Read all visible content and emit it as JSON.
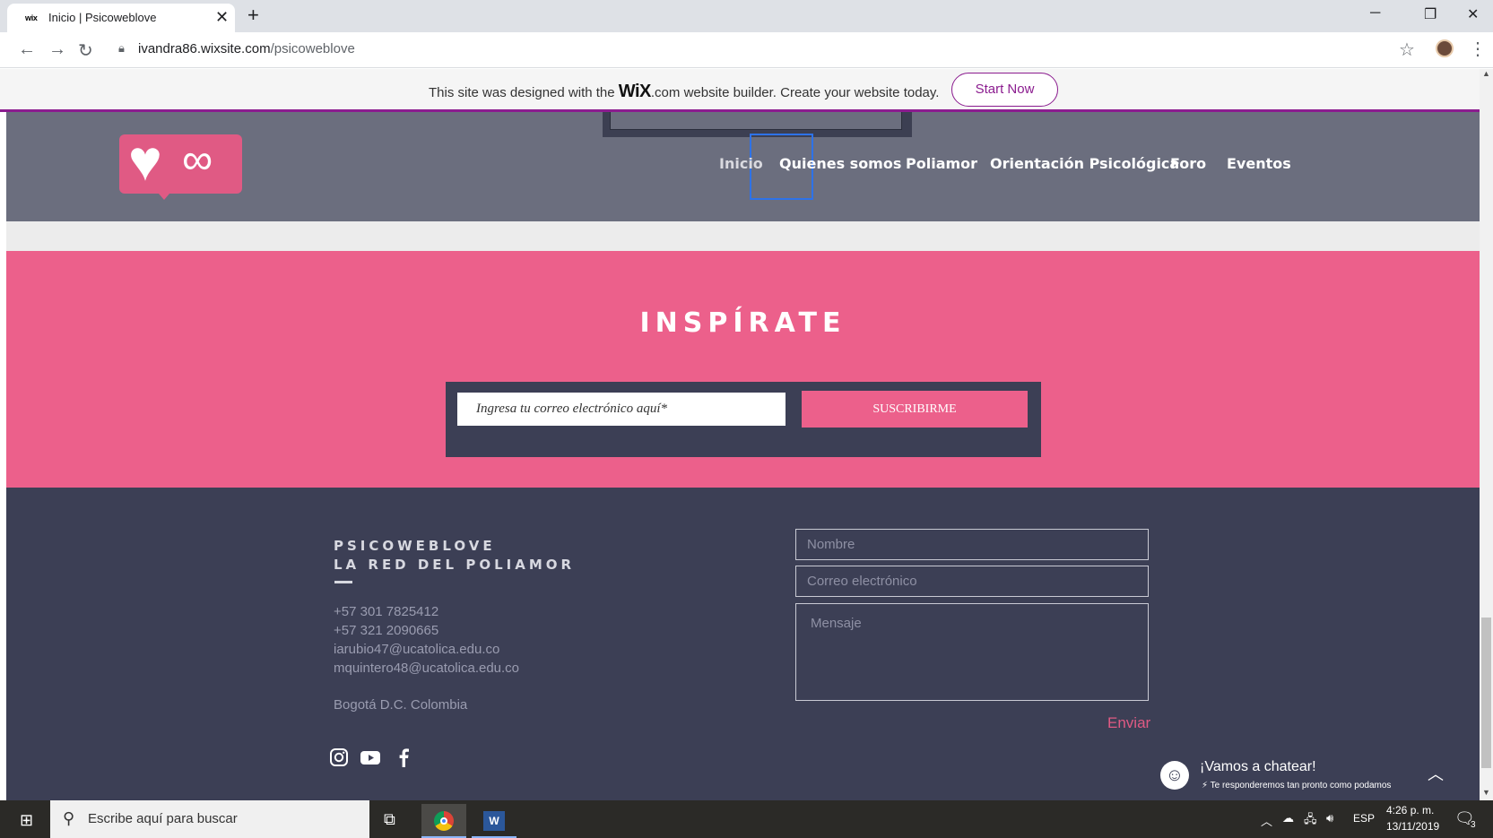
{
  "browser": {
    "tab_favicon": "wix",
    "tab_title": "Inicio | Psicoweblove",
    "tab_close": "✕",
    "new_tab": "+",
    "url_host": "ivandra86.wixsite.com",
    "url_path": "/psicoweblove"
  },
  "wix_banner": {
    "prefix": "This site was designed with the ",
    "logo": "WiX",
    "suffix": ".com website builder. Create your website today.",
    "cta": "Start Now"
  },
  "nav": {
    "items": [
      {
        "label": "Inicio"
      },
      {
        "label": "Quienes somos"
      },
      {
        "label": "Poliamor"
      },
      {
        "label": "Orientación Psicológica"
      },
      {
        "label": "Foro"
      },
      {
        "label": "Eventos"
      }
    ]
  },
  "newsletter": {
    "title": "INSPÍRATE",
    "email_placeholder": "Ingresa tu correo electrónico aquí*",
    "button": "SUSCRIBIRME"
  },
  "footer": {
    "brand_line1": "PSICOWEBLOVE",
    "brand_line2": "LA RED DEL POLIAMOR",
    "phone1": "+57 301 7825412",
    "phone2": "+57 321 2090665",
    "email1": "iarubio47@ucatolica.edu.co",
    "email2": "mquintero48@ucatolica.edu.co",
    "location": "Bogotá D.C. Colombia",
    "form": {
      "name_placeholder": "Nombre",
      "email_placeholder": "Correo electrónico",
      "message_placeholder": "Mensaje",
      "send": "Enviar"
    }
  },
  "chat": {
    "title": "¡Vamos a chatear!",
    "subtitle": "Te responderemos tan pronto como podamos"
  },
  "taskbar": {
    "search_placeholder": "Escribe aquí para buscar",
    "language": "ESP",
    "time": "4:26 p. m.",
    "date": "13/11/2019",
    "notifications": "3"
  },
  "colors": {
    "pink": "#ec608b",
    "navy": "#3c3f55",
    "header_gray": "#6b6e7e",
    "wix_purple": "#8b1c8f"
  }
}
